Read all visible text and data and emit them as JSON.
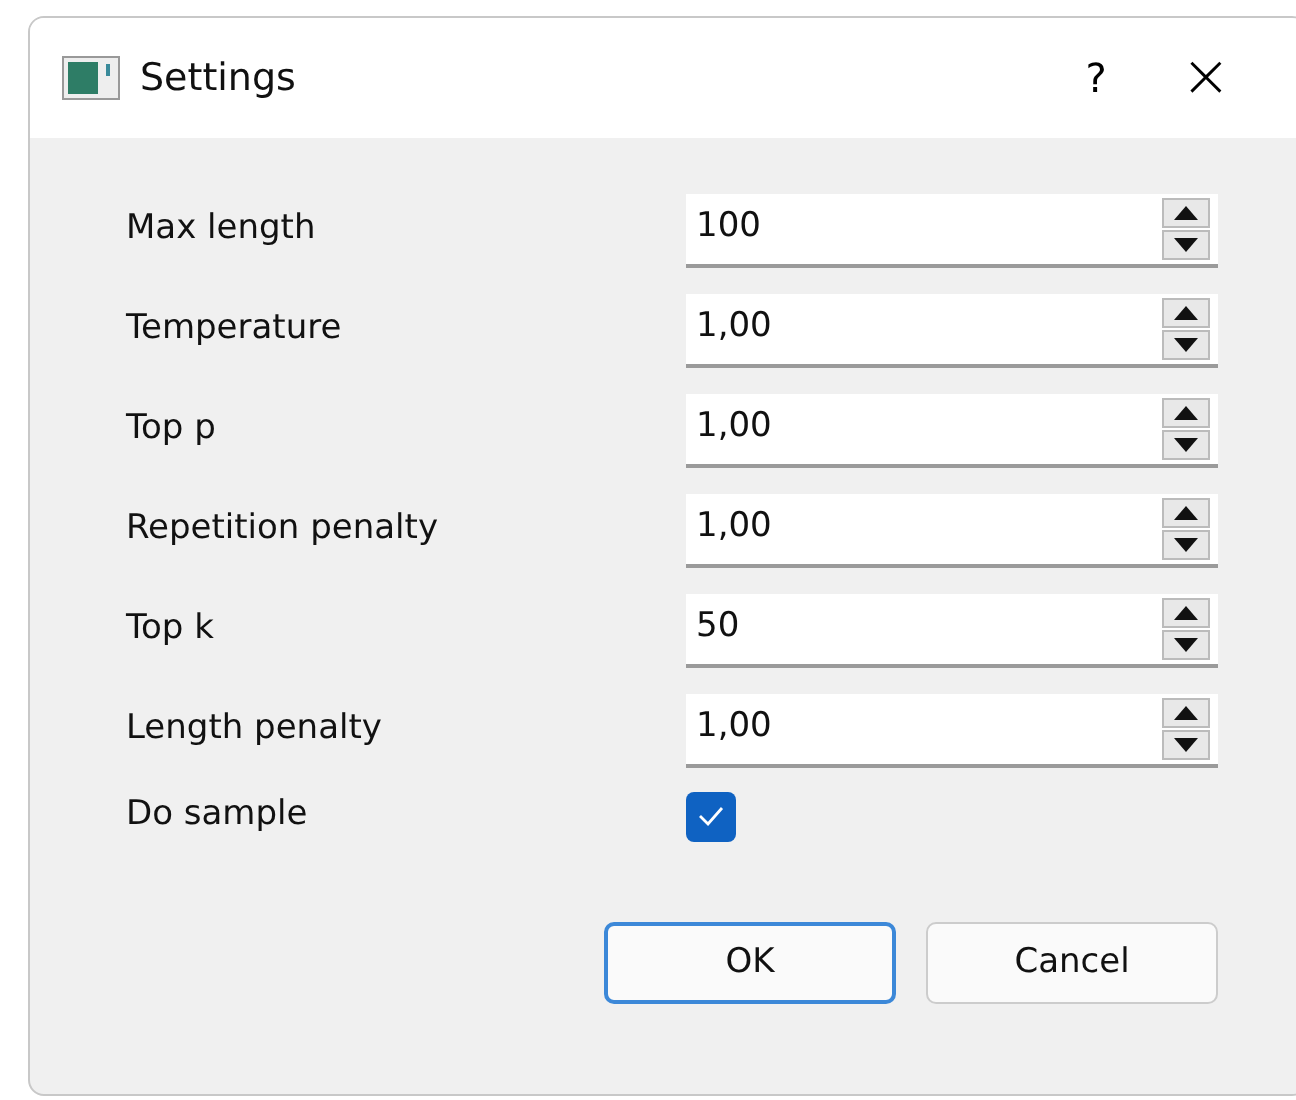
{
  "window": {
    "title": "Settings",
    "help": "?",
    "close": "×"
  },
  "fields": [
    {
      "kind": "spinbox",
      "label": "Max length",
      "value": "100"
    },
    {
      "kind": "spinbox",
      "label": "Temperature",
      "value": "1,00"
    },
    {
      "kind": "spinbox",
      "label": "Top p",
      "value": "1,00"
    },
    {
      "kind": "spinbox",
      "label": "Repetition penalty",
      "value": "1,00"
    },
    {
      "kind": "spinbox",
      "label": "Top k",
      "value": "50"
    },
    {
      "kind": "spinbox",
      "label": "Length penalty",
      "value": "1,00"
    },
    {
      "kind": "checkbox",
      "label": "Do sample",
      "checked": true
    }
  ],
  "buttons": [
    {
      "label": "OK",
      "default": true
    },
    {
      "label": "Cancel",
      "default": false
    }
  ]
}
